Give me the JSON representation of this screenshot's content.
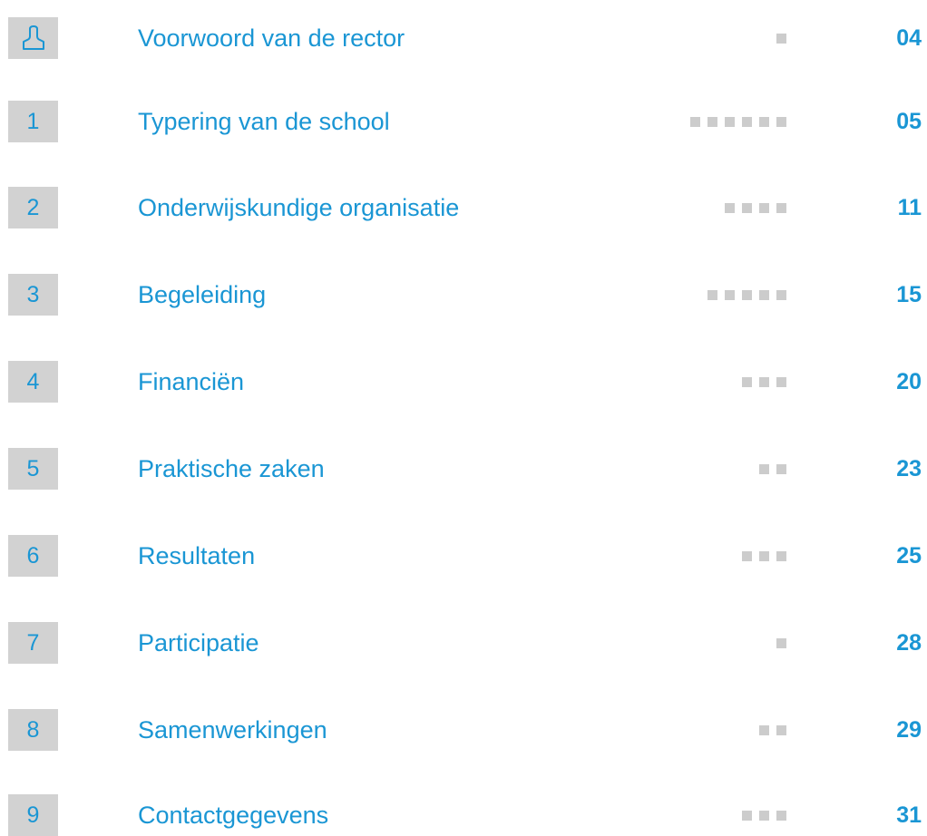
{
  "toc": {
    "entries": [
      {
        "number": "",
        "icon": "person-icon",
        "title": "Voorwoord van de rector",
        "dots": 1,
        "page": "04"
      },
      {
        "number": "1",
        "title": "Typering van de school",
        "dots": 6,
        "page": "05"
      },
      {
        "number": "2",
        "title": "Onderwijskundige organisatie",
        "dots": 4,
        "page": "11"
      },
      {
        "number": "3",
        "title": "Begeleiding",
        "dots": 5,
        "page": "15"
      },
      {
        "number": "4",
        "title": "Financiën",
        "dots": 3,
        "page": "20"
      },
      {
        "number": "5",
        "title": "Praktische zaken",
        "dots": 2,
        "page": "23"
      },
      {
        "number": "6",
        "title": "Resultaten",
        "dots": 3,
        "page": "25"
      },
      {
        "number": "7",
        "title": "Participatie",
        "dots": 1,
        "page": "28"
      },
      {
        "number": "8",
        "title": "Samenwerkingen",
        "dots": 2,
        "page": "29"
      },
      {
        "number": "9",
        "title": "Contactgegevens",
        "dots": 3,
        "page": "31"
      }
    ]
  },
  "colors": {
    "accent": "#1a96d4",
    "badge_bg": "#d2d2d2",
    "dot": "#cccccc"
  }
}
